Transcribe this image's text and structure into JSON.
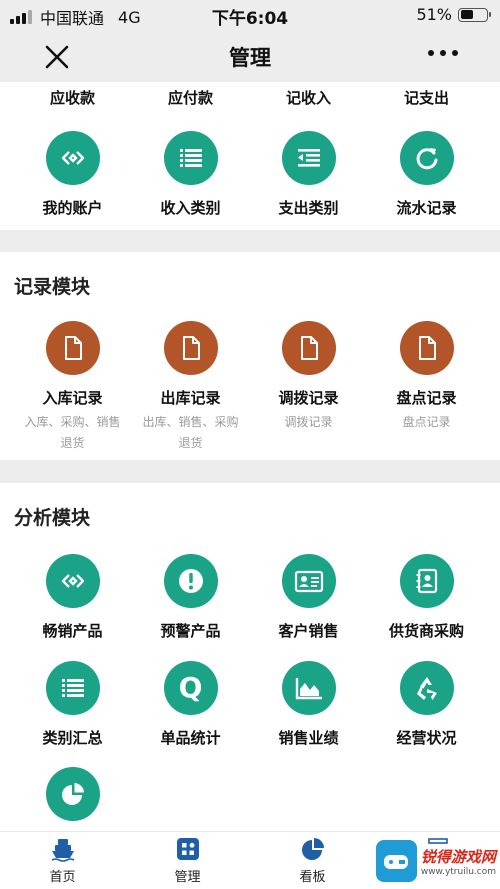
{
  "status_bar": {
    "carrier": "中国联通",
    "network": "4G",
    "time": "下午6:04",
    "battery": "51%",
    "battery_level": 0.51
  },
  "nav": {
    "title": "管理"
  },
  "top_module": {
    "cut_items": [
      "应收款",
      "应付款",
      "记收入",
      "记支出"
    ],
    "items": [
      {
        "label": "我的账户",
        "icon": "link-diamond-icon"
      },
      {
        "label": "收入类别",
        "icon": "list-icon"
      },
      {
        "label": "支出类别",
        "icon": "outdent-list-icon"
      },
      {
        "label": "流水记录",
        "icon": "refresh-icon"
      }
    ]
  },
  "record_module": {
    "title": "记录模块",
    "items": [
      {
        "label": "入库记录",
        "sub1": "入库、采购、销售",
        "sub2": "退货"
      },
      {
        "label": "出库记录",
        "sub1": "出库、销售、采购",
        "sub2": "退货"
      },
      {
        "label": "调拨记录",
        "sub1": "调拨记录",
        "sub2": ""
      },
      {
        "label": "盘点记录",
        "sub1": "盘点记录",
        "sub2": ""
      }
    ]
  },
  "analysis_module": {
    "title": "分析模块",
    "items": [
      {
        "label": "畅销产品",
        "icon": "link-diamond-icon"
      },
      {
        "label": "预警产品",
        "icon": "warning-icon"
      },
      {
        "label": "客户销售",
        "icon": "id-card-icon"
      },
      {
        "label": "供货商采购",
        "icon": "contacts-book-icon"
      },
      {
        "label": "类别汇总",
        "icon": "list-icon"
      },
      {
        "label": "单品统计",
        "icon": "q-icon",
        "glyph": "Q"
      },
      {
        "label": "销售业绩",
        "icon": "area-chart-icon"
      },
      {
        "label": "经营状况",
        "icon": "recycle-icon"
      },
      {
        "label": "",
        "icon": "pie-chart-icon"
      }
    ]
  },
  "tab_bar": {
    "tabs": [
      {
        "label": "首页",
        "icon": "ship-icon"
      },
      {
        "label": "管理",
        "icon": "grid-apps-icon"
      },
      {
        "label": "看板",
        "icon": "pie-chart-icon"
      },
      {
        "label": "",
        "icon": "partial-icon"
      }
    ]
  },
  "watermark": {
    "name": "锐得游戏网",
    "url": "www.ytruilu.com"
  },
  "colors": {
    "teal": "#1aa387",
    "brown": "#b25629",
    "background": "#ededed"
  }
}
